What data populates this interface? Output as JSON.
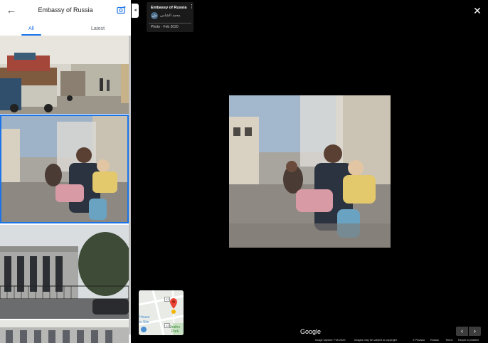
{
  "panel": {
    "title": "Embassy of Russia",
    "back_icon": "arrow-left-icon",
    "camera_icon": "add-photo-icon",
    "tabs": [
      {
        "label": "All",
        "active": true
      },
      {
        "label": "Latest",
        "active": false
      }
    ]
  },
  "viewer": {
    "info": {
      "title": "Embassy of Russia",
      "user": "محمد الشامي",
      "avatar_text": "ش",
      "date": "Photo - Feb 2020"
    },
    "collapse_glyph": "◂",
    "close_glyph": "✕",
    "nav": {
      "prev": "‹",
      "next": "›"
    },
    "logo": "Google",
    "footer": {
      "capture": "Image capture: Feb 2020",
      "copyright": "Images may be subject to copyright.",
      "osm": "© Picasso",
      "country": "Russia",
      "terms": "Terms",
      "report": "Report a problem"
    }
  },
  "minimap": {
    "label_house": "House",
    "label_site": "ic Site",
    "label_park": "Stratho",
    "label_park2": "Park",
    "road_1": "43",
    "road_2": "43"
  },
  "colors": {
    "accent": "#1a73e8",
    "pin": "#ea4335"
  }
}
